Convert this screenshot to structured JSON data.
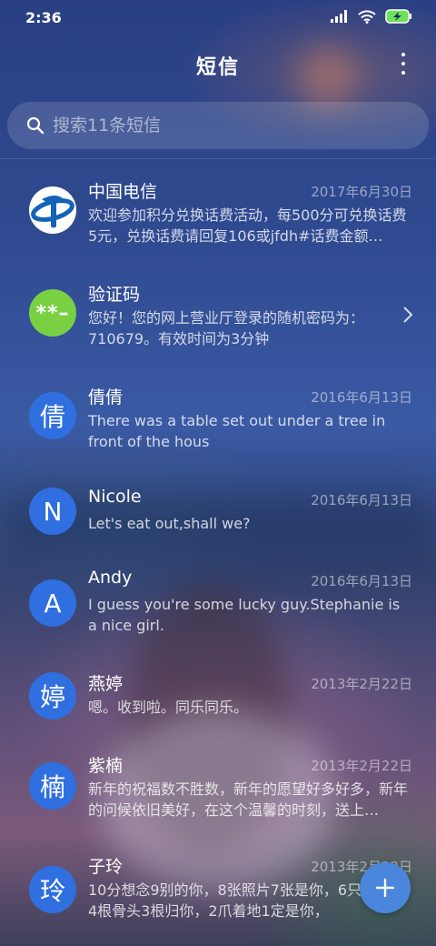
{
  "status_bar": {
    "time": "2:36",
    "icons": [
      "signal-icon",
      "wifi-icon",
      "battery-charging-icon"
    ]
  },
  "header": {
    "title": "短信",
    "more_icon": "more-vertical-icon"
  },
  "search": {
    "placeholder": "搜索11条短信",
    "icon": "search-icon"
  },
  "conversations": [
    {
      "name": "中国电信",
      "date": "2017年6月30日",
      "preview": "欢迎参加积分兑换话费活动，每500分可兑换话费5元，兑换话费请回复106或jfdh#话费金额…",
      "avatar_type": "telecom-logo"
    },
    {
      "name": "验证码",
      "date": "",
      "preview": "您好！您的网上营业厅登录的随机密码为：710679。有效时间为3分钟",
      "avatar_text": "**–",
      "avatar_type": "green"
    },
    {
      "name": "倩倩",
      "date": "2016年6月13日",
      "preview": "There was a table set out under a tree in front of the hous",
      "avatar_text": "倩",
      "avatar_type": "blue"
    },
    {
      "name": "Nicole",
      "date": "2016年6月13日",
      "preview": "Let's eat out,shall we?",
      "avatar_text": "N",
      "avatar_type": "blue"
    },
    {
      "name": "Andy",
      "date": "2016年6月13日",
      "preview": "I guess you're some lucky guy.Stephanie is a nice girl.",
      "avatar_text": "A",
      "avatar_type": "blue"
    },
    {
      "name": "燕婷",
      "date": "2013年2月22日",
      "preview": "嗯。收到啦。同乐同乐。",
      "avatar_text": "婷",
      "avatar_type": "blue"
    },
    {
      "name": "紫楠",
      "date": "2013年2月22日",
      "preview": "新年的祝福数不胜数，新年的愿望好多好多，新年的问候依旧美好，在这个温馨的时刻，送上…",
      "avatar_text": "楠",
      "avatar_type": "blue"
    },
    {
      "name": "子玲",
      "date": "2013年2月22日",
      "preview": "10分想念9别的你，8张照片7张是你，6只像你，4根骨头3根归你，2爪着地1定是你，",
      "avatar_text": "玲",
      "avatar_type": "blue"
    }
  ],
  "fab": {
    "icon": "plus-icon"
  },
  "colors": {
    "accent": "#2f6fe0",
    "verify_green": "#7ad043",
    "fab": "#4b86dd"
  }
}
